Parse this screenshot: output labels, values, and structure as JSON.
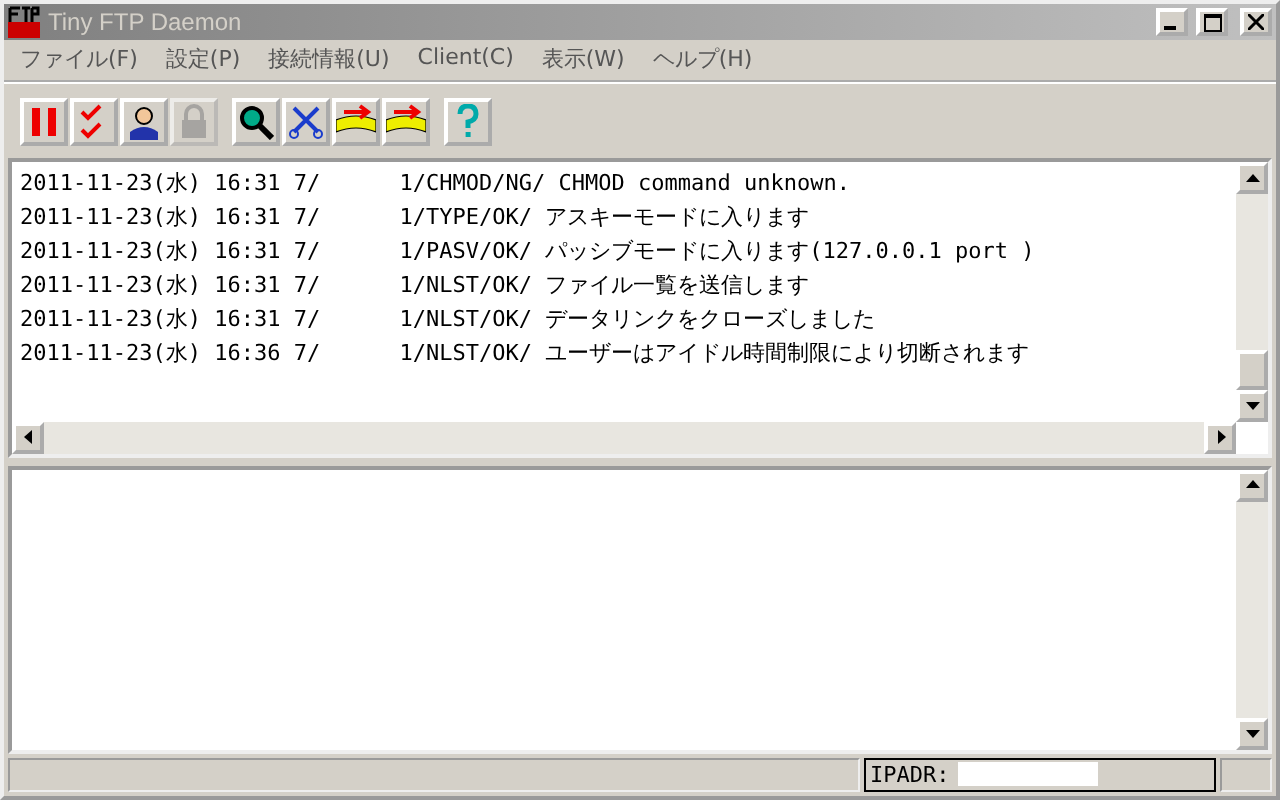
{
  "window": {
    "title": "Tiny FTP Daemon",
    "active": false
  },
  "menu": [
    {
      "label": "ファイル(F)"
    },
    {
      "label": "設定(P)"
    },
    {
      "label": "接続情報(U)"
    },
    {
      "label": "Client(C)"
    },
    {
      "label": "表示(W)"
    },
    {
      "label": "ヘルプ(H)"
    }
  ],
  "toolbar_groups": [
    [
      {
        "kind": "pause",
        "disabled": false
      },
      {
        "kind": "checklist",
        "disabled": false
      },
      {
        "kind": "user",
        "disabled": false
      },
      {
        "kind": "lock",
        "disabled": true
      }
    ],
    [
      {
        "kind": "search",
        "disabled": false
      },
      {
        "kind": "cut",
        "disabled": false
      },
      {
        "kind": "transfer",
        "disabled": false
      },
      {
        "kind": "transfer",
        "disabled": false
      }
    ],
    [
      {
        "kind": "help",
        "disabled": false
      }
    ]
  ],
  "log": [
    {
      "time": "2011-11-23(水) 16:31 7/",
      "session": "1/CHMOD/NG/",
      "message": "CHMOD command unknown."
    },
    {
      "time": "2011-11-23(水) 16:31 7/",
      "session": "1/TYPE/OK/",
      "message": "アスキーモードに入ります"
    },
    {
      "time": "2011-11-23(水) 16:31 7/",
      "session": "1/PASV/OK/",
      "message": "パッシブモードに入ります(127.0.0.1 port )"
    },
    {
      "time": "2011-11-23(水) 16:31 7/",
      "session": "1/NLST/OK/",
      "message": "ファイル一覧を送信します"
    },
    {
      "time": "2011-11-23(水) 16:31 7/",
      "session": "1/NLST/OK/",
      "message": "データリンクをクローズしました"
    },
    {
      "time": "2011-11-23(水) 16:36 7/",
      "session": "1/NLST/OK/",
      "message": "ユーザーはアイドル時間制限により切断されます"
    }
  ],
  "status_bar": {
    "ip_label": "IPADR:"
  }
}
